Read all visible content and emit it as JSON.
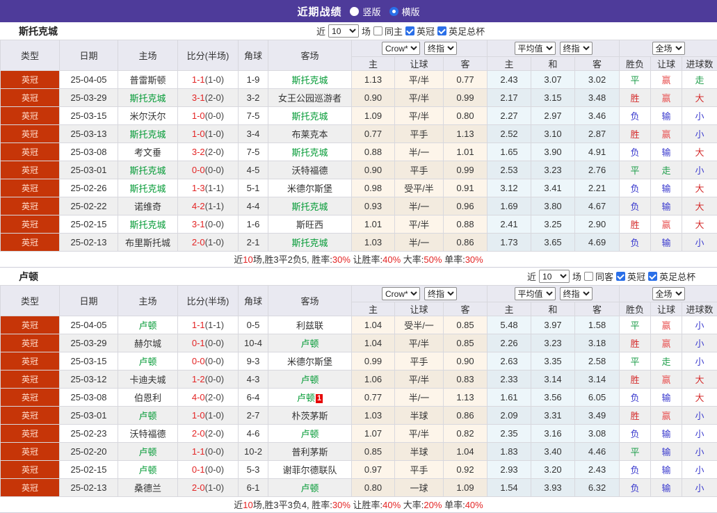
{
  "title_bar": {
    "title": "近期战绩",
    "radio_options": [
      {
        "label": "竖版",
        "selected": false
      },
      {
        "label": "横版",
        "selected": true
      }
    ]
  },
  "table_header": {
    "left_columns": [
      "类型",
      "日期",
      "主场",
      "比分(半场)",
      "角球",
      "客场"
    ],
    "group1": {
      "select1": "Crow*",
      "select2": "终指",
      "sub": [
        "主",
        "让球",
        "客"
      ]
    },
    "group2": {
      "select1": "平均值",
      "select2": "终指",
      "sub": [
        "主",
        "和",
        "客"
      ]
    },
    "group3": {
      "select1": "全场",
      "sub": [
        "胜负",
        "让球",
        "进球数"
      ]
    }
  },
  "result_colors": {
    "胜": "#d42b2b",
    "大": "#d42b2b",
    "赢": "#e85757",
    "平": "#1e9e4a",
    "走": "#1e9e4a",
    "负": "#3a3ace",
    "输": "#3a3ace",
    "小": "#3a3ace"
  },
  "accent_colors": {
    "type_badge_bg": "#c63508",
    "team_highlight": "#009933",
    "score_red": "#e32424",
    "titlebar_purple": "#4e3b9a"
  },
  "sections": [
    {
      "team": "斯托克城",
      "filters": {
        "prefix": "近",
        "count": "10",
        "suffix": "场",
        "same": {
          "label": "同主",
          "checked": false
        },
        "league": {
          "label": "英冠",
          "checked": true
        },
        "cup": {
          "label": "英足总杯",
          "checked": true
        }
      },
      "rows": [
        {
          "type": "英冠",
          "date": "25-04-05",
          "home": "普雷斯顿",
          "home_hl": false,
          "ft": "1-1",
          "ht": "(1-0)",
          "corner": "1-9",
          "away": "斯托克城",
          "away_hl": true,
          "badge": "",
          "odds": [
            "1.13",
            "平/半",
            "0.77"
          ],
          "avg": [
            "2.43",
            "3.07",
            "3.02"
          ],
          "res": [
            "平",
            "赢",
            "走"
          ]
        },
        {
          "type": "英冠",
          "date": "25-03-29",
          "home": "斯托克城",
          "home_hl": true,
          "ft": "3-1",
          "ht": "(2-0)",
          "corner": "3-2",
          "away": "女王公园巡游者",
          "away_hl": false,
          "badge": "",
          "odds": [
            "0.90",
            "平/半",
            "0.99"
          ],
          "avg": [
            "2.17",
            "3.15",
            "3.48"
          ],
          "res": [
            "胜",
            "赢",
            "大"
          ]
        },
        {
          "type": "英冠",
          "date": "25-03-15",
          "home": "米尔沃尔",
          "home_hl": false,
          "ft": "1-0",
          "ht": "(0-0)",
          "corner": "7-5",
          "away": "斯托克城",
          "away_hl": true,
          "badge": "",
          "odds": [
            "1.09",
            "平/半",
            "0.80"
          ],
          "avg": [
            "2.27",
            "2.97",
            "3.46"
          ],
          "res": [
            "负",
            "输",
            "小"
          ]
        },
        {
          "type": "英冠",
          "date": "25-03-13",
          "home": "斯托克城",
          "home_hl": true,
          "ft": "1-0",
          "ht": "(1-0)",
          "corner": "3-4",
          "away": "布莱克本",
          "away_hl": false,
          "badge": "",
          "odds": [
            "0.77",
            "平手",
            "1.13"
          ],
          "avg": [
            "2.52",
            "3.10",
            "2.87"
          ],
          "res": [
            "胜",
            "赢",
            "小"
          ]
        },
        {
          "type": "英冠",
          "date": "25-03-08",
          "home": "考文垂",
          "home_hl": false,
          "ft": "3-2",
          "ht": "(2-0)",
          "corner": "7-5",
          "away": "斯托克城",
          "away_hl": true,
          "badge": "",
          "odds": [
            "0.88",
            "半/一",
            "1.01"
          ],
          "avg": [
            "1.65",
            "3.90",
            "4.91"
          ],
          "res": [
            "负",
            "输",
            "大"
          ]
        },
        {
          "type": "英冠",
          "date": "25-03-01",
          "home": "斯托克城",
          "home_hl": true,
          "ft": "0-0",
          "ht": "(0-0)",
          "corner": "4-5",
          "away": "沃特福德",
          "away_hl": false,
          "badge": "",
          "odds": [
            "0.90",
            "平手",
            "0.99"
          ],
          "avg": [
            "2.53",
            "3.23",
            "2.76"
          ],
          "res": [
            "平",
            "走",
            "小"
          ]
        },
        {
          "type": "英冠",
          "date": "25-02-26",
          "home": "斯托克城",
          "home_hl": true,
          "ft": "1-3",
          "ht": "(1-1)",
          "corner": "5-1",
          "away": "米德尔斯堡",
          "away_hl": false,
          "badge": "",
          "odds": [
            "0.98",
            "受平/半",
            "0.91"
          ],
          "avg": [
            "3.12",
            "3.41",
            "2.21"
          ],
          "res": [
            "负",
            "输",
            "大"
          ]
        },
        {
          "type": "英冠",
          "date": "25-02-22",
          "home": "诺维奇",
          "home_hl": false,
          "ft": "4-2",
          "ht": "(1-1)",
          "corner": "4-4",
          "away": "斯托克城",
          "away_hl": true,
          "badge": "",
          "odds": [
            "0.93",
            "半/一",
            "0.96"
          ],
          "avg": [
            "1.69",
            "3.80",
            "4.67"
          ],
          "res": [
            "负",
            "输",
            "大"
          ]
        },
        {
          "type": "英冠",
          "date": "25-02-15",
          "home": "斯托克城",
          "home_hl": true,
          "ft": "3-1",
          "ht": "(0-0)",
          "corner": "1-6",
          "away": "斯旺西",
          "away_hl": false,
          "badge": "",
          "odds": [
            "1.01",
            "平/半",
            "0.88"
          ],
          "avg": [
            "2.41",
            "3.25",
            "2.90"
          ],
          "res": [
            "胜",
            "赢",
            "大"
          ]
        },
        {
          "type": "英冠",
          "date": "25-02-13",
          "home": "布里斯托城",
          "home_hl": false,
          "ft": "2-0",
          "ht": "(1-0)",
          "corner": "2-1",
          "away": "斯托克城",
          "away_hl": true,
          "badge": "",
          "odds": [
            "1.03",
            "半/一",
            "0.86"
          ],
          "avg": [
            "1.73",
            "3.65",
            "4.69"
          ],
          "res": [
            "负",
            "输",
            "小"
          ]
        }
      ],
      "summary": [
        {
          "t": "近"
        },
        {
          "t": "10",
          "red": true
        },
        {
          "t": "场,胜3平2负5, 胜率:"
        },
        {
          "t": "30%",
          "red": true
        },
        {
          "t": " 让胜率:"
        },
        {
          "t": "40%",
          "red": true
        },
        {
          "t": " 大率:"
        },
        {
          "t": "50%",
          "red": true
        },
        {
          "t": " 单率:"
        },
        {
          "t": "30%",
          "red": true
        }
      ]
    },
    {
      "team": "卢顿",
      "filters": {
        "prefix": "近",
        "count": "10",
        "suffix": "场",
        "same": {
          "label": "同客",
          "checked": false
        },
        "league": {
          "label": "英冠",
          "checked": true
        },
        "cup": {
          "label": "英足总杯",
          "checked": true
        }
      },
      "rows": [
        {
          "type": "英冠",
          "date": "25-04-05",
          "home": "卢顿",
          "home_hl": true,
          "ft": "1-1",
          "ht": "(1-1)",
          "corner": "0-5",
          "away": "利兹联",
          "away_hl": false,
          "badge": "",
          "odds": [
            "1.04",
            "受半/一",
            "0.85"
          ],
          "avg": [
            "5.48",
            "3.97",
            "1.58"
          ],
          "res": [
            "平",
            "赢",
            "小"
          ]
        },
        {
          "type": "英冠",
          "date": "25-03-29",
          "home": "赫尔城",
          "home_hl": false,
          "ft": "0-1",
          "ht": "(0-0)",
          "corner": "10-4",
          "away": "卢顿",
          "away_hl": true,
          "badge": "",
          "odds": [
            "1.04",
            "平/半",
            "0.85"
          ],
          "avg": [
            "2.26",
            "3.23",
            "3.18"
          ],
          "res": [
            "胜",
            "赢",
            "小"
          ]
        },
        {
          "type": "英冠",
          "date": "25-03-15",
          "home": "卢顿",
          "home_hl": true,
          "ft": "0-0",
          "ht": "(0-0)",
          "corner": "9-3",
          "away": "米德尔斯堡",
          "away_hl": false,
          "badge": "",
          "odds": [
            "0.99",
            "平手",
            "0.90"
          ],
          "avg": [
            "2.63",
            "3.35",
            "2.58"
          ],
          "res": [
            "平",
            "走",
            "小"
          ]
        },
        {
          "type": "英冠",
          "date": "25-03-12",
          "home": "卡迪夫城",
          "home_hl": false,
          "ft": "1-2",
          "ht": "(0-0)",
          "corner": "4-3",
          "away": "卢顿",
          "away_hl": true,
          "badge": "",
          "odds": [
            "1.06",
            "平/半",
            "0.83"
          ],
          "avg": [
            "2.33",
            "3.14",
            "3.14"
          ],
          "res": [
            "胜",
            "赢",
            "大"
          ]
        },
        {
          "type": "英冠",
          "date": "25-03-08",
          "home": "伯恩利",
          "home_hl": false,
          "ft": "4-0",
          "ht": "(2-0)",
          "corner": "6-4",
          "away": "卢顿",
          "away_hl": true,
          "badge": "1",
          "odds": [
            "0.77",
            "半/一",
            "1.13"
          ],
          "avg": [
            "1.61",
            "3.56",
            "6.05"
          ],
          "res": [
            "负",
            "输",
            "大"
          ]
        },
        {
          "type": "英冠",
          "date": "25-03-01",
          "home": "卢顿",
          "home_hl": true,
          "ft": "1-0",
          "ht": "(1-0)",
          "corner": "2-7",
          "away": "朴茨茅斯",
          "away_hl": false,
          "badge": "",
          "odds": [
            "1.03",
            "半球",
            "0.86"
          ],
          "avg": [
            "2.09",
            "3.31",
            "3.49"
          ],
          "res": [
            "胜",
            "赢",
            "小"
          ]
        },
        {
          "type": "英冠",
          "date": "25-02-23",
          "home": "沃特福德",
          "home_hl": false,
          "ft": "2-0",
          "ht": "(2-0)",
          "corner": "4-6",
          "away": "卢顿",
          "away_hl": true,
          "badge": "",
          "odds": [
            "1.07",
            "平/半",
            "0.82"
          ],
          "avg": [
            "2.35",
            "3.16",
            "3.08"
          ],
          "res": [
            "负",
            "输",
            "小"
          ]
        },
        {
          "type": "英冠",
          "date": "25-02-20",
          "home": "卢顿",
          "home_hl": true,
          "ft": "1-1",
          "ht": "(0-0)",
          "corner": "10-2",
          "away": "普利茅斯",
          "away_hl": false,
          "badge": "",
          "odds": [
            "0.85",
            "半球",
            "1.04"
          ],
          "avg": [
            "1.83",
            "3.40",
            "4.46"
          ],
          "res": [
            "平",
            "输",
            "小"
          ]
        },
        {
          "type": "英冠",
          "date": "25-02-15",
          "home": "卢顿",
          "home_hl": true,
          "ft": "0-1",
          "ht": "(0-0)",
          "corner": "5-3",
          "away": "谢菲尔德联队",
          "away_hl": false,
          "badge": "",
          "odds": [
            "0.97",
            "平手",
            "0.92"
          ],
          "avg": [
            "2.93",
            "3.20",
            "2.43"
          ],
          "res": [
            "负",
            "输",
            "小"
          ]
        },
        {
          "type": "英冠",
          "date": "25-02-13",
          "home": "桑德兰",
          "home_hl": false,
          "ft": "2-0",
          "ht": "(1-0)",
          "corner": "6-1",
          "away": "卢顿",
          "away_hl": true,
          "badge": "",
          "odds": [
            "0.80",
            "一球",
            "1.09"
          ],
          "avg": [
            "1.54",
            "3.93",
            "6.32"
          ],
          "res": [
            "负",
            "输",
            "小"
          ]
        }
      ],
      "summary": [
        {
          "t": "近"
        },
        {
          "t": "10",
          "red": true
        },
        {
          "t": "场,胜3平3负4, 胜率:"
        },
        {
          "t": "30%",
          "red": true
        },
        {
          "t": " 让胜率:"
        },
        {
          "t": "40%",
          "red": true
        },
        {
          "t": " 大率:"
        },
        {
          "t": "20%",
          "red": true
        },
        {
          "t": " 单率:"
        },
        {
          "t": "40%",
          "red": true
        }
      ]
    }
  ]
}
